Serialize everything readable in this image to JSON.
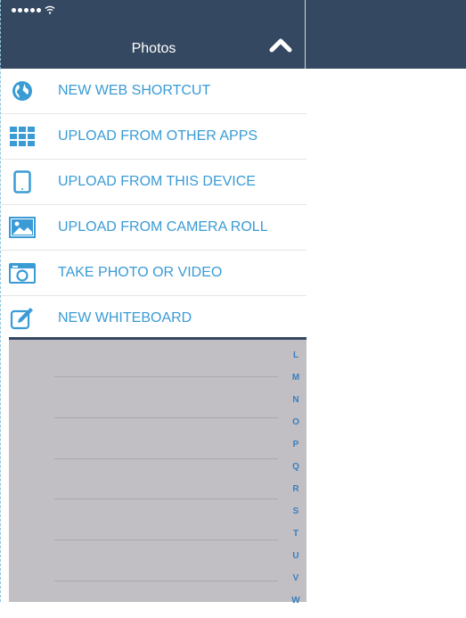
{
  "header": {
    "title": "Photos"
  },
  "menu": {
    "items": [
      {
        "label": "NEW WEB SHORTCUT",
        "icon": "globe-icon"
      },
      {
        "label": "UPLOAD FROM OTHER APPS",
        "icon": "grid-icon"
      },
      {
        "label": "UPLOAD FROM THIS DEVICE",
        "icon": "tablet-icon"
      },
      {
        "label": "UPLOAD FROM CAMERA ROLL",
        "icon": "image-icon"
      },
      {
        "label": "TAKE PHOTO OR VIDEO",
        "icon": "camera-icon"
      },
      {
        "label": "NEW WHITEBOARD",
        "icon": "pencil-icon"
      }
    ]
  },
  "index": {
    "letters": [
      "L",
      "M",
      "N",
      "O",
      "P",
      "Q",
      "R",
      "S",
      "T",
      "U",
      "V",
      "W"
    ]
  },
  "colors": {
    "header": "#354861",
    "accent": "#3a9bd5",
    "list_bg": "#c1bfc3"
  }
}
